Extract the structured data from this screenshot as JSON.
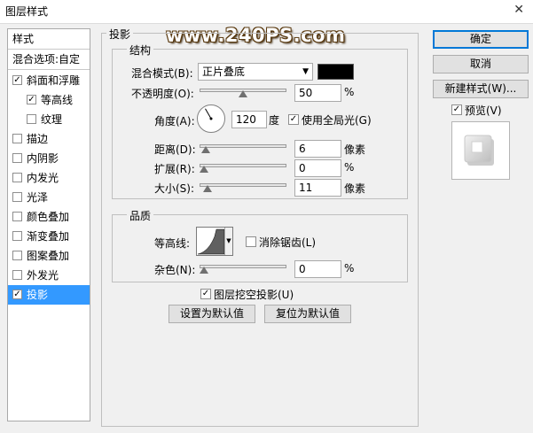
{
  "window": {
    "title": "图层样式",
    "close_glyph": "✕"
  },
  "left_panel": {
    "header": "样式",
    "blend_options": "混合选项:自定",
    "items": [
      {
        "label": "斜面和浮雕",
        "checked": true,
        "indent": false
      },
      {
        "label": "等高线",
        "checked": true,
        "indent": true
      },
      {
        "label": "纹理",
        "checked": false,
        "indent": true
      },
      {
        "label": "描边",
        "checked": false,
        "indent": false
      },
      {
        "label": "内阴影",
        "checked": false,
        "indent": false
      },
      {
        "label": "内发光",
        "checked": false,
        "indent": false
      },
      {
        "label": "光泽",
        "checked": false,
        "indent": false
      },
      {
        "label": "颜色叠加",
        "checked": false,
        "indent": false
      },
      {
        "label": "渐变叠加",
        "checked": false,
        "indent": false
      },
      {
        "label": "图案叠加",
        "checked": false,
        "indent": false
      },
      {
        "label": "外发光",
        "checked": false,
        "indent": false
      },
      {
        "label": "投影",
        "checked": true,
        "indent": false,
        "selected": true
      }
    ]
  },
  "drop_shadow": {
    "section_title": "投影",
    "structure_title": "结构",
    "blend_mode_label": "混合模式(B):",
    "blend_mode_value": "正片叠底",
    "blend_color": "#000000",
    "opacity_label": "不透明度(O):",
    "opacity_value": "50",
    "opacity_unit": "%",
    "opacity_level": 0.5,
    "angle_label": "角度(A):",
    "angle_value": "120",
    "angle_unit": "度",
    "global_light_label": "使用全局光(G)",
    "global_light_checked": true,
    "distance_label": "距离(D):",
    "distance_value": "6",
    "distance_unit": "像素",
    "distance_level": 0.02,
    "spread_label": "扩展(R):",
    "spread_value": "0",
    "spread_unit": "%",
    "spread_level": 0,
    "size_label": "大小(S):",
    "size_value": "11",
    "size_unit": "像素",
    "size_level": 0.04,
    "quality_title": "品质",
    "contour_label": "等高线:",
    "anti_alias_label": "消除锯齿(L)",
    "anti_alias_checked": false,
    "noise_label": "杂色(N):",
    "noise_value": "0",
    "noise_unit": "%",
    "noise_level": 0,
    "knockout_label": "图层挖空投影(U)",
    "knockout_checked": true,
    "make_default_label": "设置为默认值",
    "reset_default_label": "复位为默认值"
  },
  "right_panel": {
    "ok_label": "确定",
    "cancel_label": "取消",
    "new_style_label": "新建样式(W)...",
    "preview_label": "预览(V)",
    "preview_checked": true
  },
  "watermark": "www.240PS.com",
  "check_glyph": "✓",
  "dropdown_arrow": "▼"
}
